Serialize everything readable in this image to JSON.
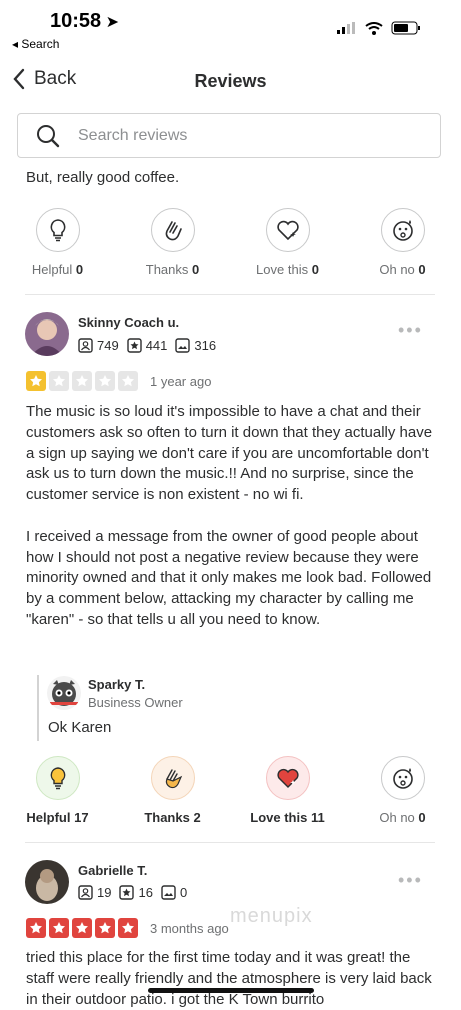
{
  "status_bar": {
    "time": "10:58",
    "back_app": "Search"
  },
  "nav": {
    "back_label": "Back",
    "title": "Reviews"
  },
  "search": {
    "placeholder": "Search reviews"
  },
  "previous_review": {
    "tail_text": "But, really good coffee.",
    "reactions": [
      {
        "label": "Helpful",
        "count": "0",
        "icon": "bulb-icon"
      },
      {
        "label": "Thanks",
        "count": "0",
        "icon": "clap-icon"
      },
      {
        "label": "Love this",
        "count": "0",
        "icon": "heart-icon"
      },
      {
        "label": "Oh no",
        "count": "0",
        "icon": "oh-no-icon"
      }
    ]
  },
  "reviews": [
    {
      "user": "Skinny Coach u.",
      "friends": "749",
      "reviews": "441",
      "photos": "316",
      "rating": 1,
      "time_ago": "1 year ago",
      "text": "The music is so loud it's impossible to have a chat and their customers ask so often to turn it down that they actually have a sign up saying we don't care if you are uncomfortable don't ask us to turn down the music.!! And no surprise, since the customer service is non existent - no wi fi.\n\nI received a message from the owner of good people about how I should not post a negative review because they were minority owned and that it only makes me look bad. Followed by a comment below, attacking my character by calling me \"karen\" - so that tells u all you need to know.",
      "owner_reply": {
        "name": "Sparky T.",
        "role": "Business Owner",
        "text": "Ok Karen"
      },
      "reactions": [
        {
          "label": "Helpful",
          "count": "17",
          "icon": "bulb-icon"
        },
        {
          "label": "Thanks",
          "count": "2",
          "icon": "clap-icon"
        },
        {
          "label": "Love this",
          "count": "11",
          "icon": "heart-icon"
        },
        {
          "label": "Oh no",
          "count": "0",
          "icon": "oh-no-icon"
        }
      ]
    },
    {
      "user": "Gabrielle T.",
      "friends": "19",
      "reviews": "16",
      "photos": "0",
      "rating": 5,
      "time_ago": "3 months ago",
      "text": "tried this place for the first time today and it was great! the staff were really friendly and the atmosphere is very laid back in their outdoor patio. i got the K Town burrito"
    }
  ],
  "watermark": "menupix",
  "colors": {
    "star_low": "#f4c12f",
    "star_high": "#e0443e",
    "text": "#2d2e2f",
    "muted": "#6e7072"
  }
}
